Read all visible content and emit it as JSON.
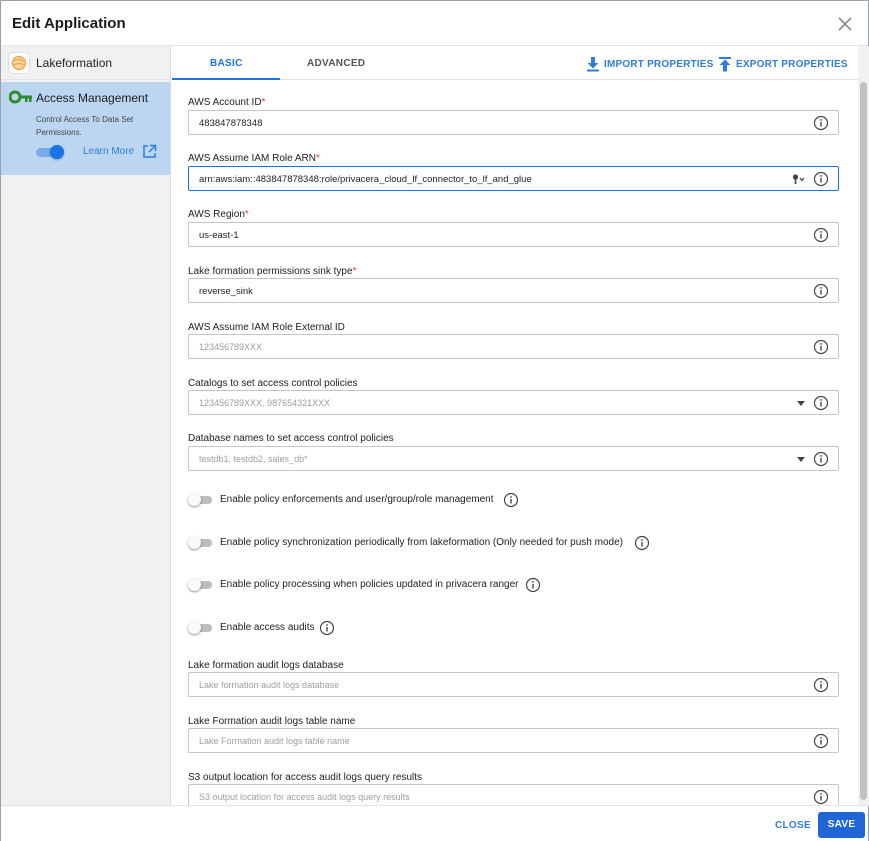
{
  "dialog": {
    "title": "Edit Application"
  },
  "sidebar": {
    "app_name": "Lakeformation",
    "active_item": {
      "title": "Access Management",
      "description": "Control Access To Data Set Permissions.",
      "enabled": true,
      "learn_more": "Learn More"
    }
  },
  "tabs": {
    "basic": "BASIC",
    "advanced": "ADVANCED",
    "active": "BASIC"
  },
  "toolbar": {
    "import": "IMPORT PROPERTIES",
    "export": "EXPORT PROPERTIES"
  },
  "fields": [
    {
      "label": "AWS Account ID",
      "required": true,
      "value": "483847878348",
      "placeholder": ""
    },
    {
      "label": "AWS Assume IAM Role ARN",
      "required": true,
      "value": "arn:aws:iam::483847878348:role/privacera_cloud_lf_connector_to_lf_and_glue",
      "placeholder": ""
    },
    {
      "label": "AWS Region",
      "required": true,
      "value": "us-east-1",
      "placeholder": ""
    },
    {
      "label": "Lake formation permissions sink type",
      "required": true,
      "value": "reverse_sink",
      "placeholder": ""
    },
    {
      "label": "AWS Assume IAM Role External ID",
      "required": false,
      "value": "",
      "placeholder": "123456789XXX"
    },
    {
      "label": "Catalogs to set access control policies",
      "required": false,
      "value": "",
      "placeholder": "123456789XXX, 987654321XXX"
    },
    {
      "label": "Database names to set access control policies",
      "required": false,
      "value": "",
      "placeholder": "testdb1, testdb2, sales_db*"
    }
  ],
  "required_marker": "*",
  "toggles": [
    {
      "label": "Enable policy enforcements and user/group/role management",
      "on": false
    },
    {
      "label": "Enable policy synchronization periodically from lakeformation (Only needed for push mode)",
      "on": false
    },
    {
      "label": "Enable policy processing when policies updated in privacera ranger",
      "on": false
    },
    {
      "label": "Enable access audits",
      "on": false
    }
  ],
  "audit_fields": [
    {
      "label": "Lake formation audit logs database",
      "value": "",
      "placeholder": "Lake formation audit logs database"
    },
    {
      "label": "Lake Formation audit logs table name",
      "value": "",
      "placeholder": "Lake Formation audit logs table name"
    },
    {
      "label": "S3 output location for access audit logs query results",
      "value": "",
      "placeholder": "S3 output location for access audit logs query results"
    }
  ],
  "footer": {
    "close": "CLOSE",
    "save": "SAVE"
  },
  "colors": {
    "accent": "#1a73e8",
    "required": "#e53935",
    "sidebar_active": "#bcd6f1",
    "save_button": "#2166d7"
  },
  "icons": {
    "app": "lakeformation-logo-icon",
    "access": "key-icon",
    "learn_more": "external-link-icon",
    "import": "download-icon",
    "export": "upload-icon",
    "info": "info-icon",
    "close": "close-icon"
  }
}
